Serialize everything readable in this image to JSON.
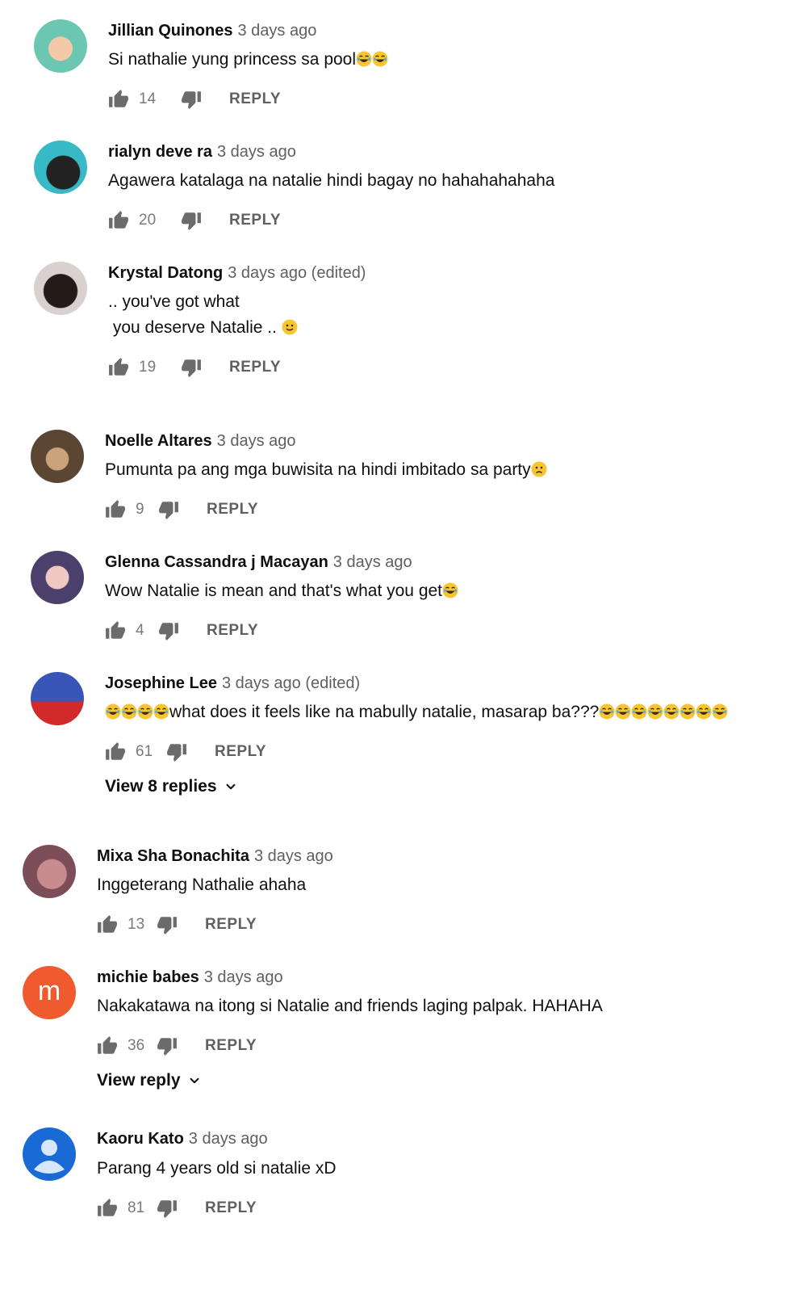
{
  "ui": {
    "reply_label": "REPLY"
  },
  "comments": [
    {
      "author": "Jillian Quinones",
      "time": "3 days ago",
      "line1": "Si nathalie yung princess sa pool",
      "likes": "14",
      "avatar_colors": [
        "#6cc7b2",
        "#f3c9a8"
      ]
    },
    {
      "author": "rialyn deve ra",
      "time": "3 days ago",
      "line1": "Agawera katalaga na natalie hindi bagay no hahahahahaha",
      "likes": "20",
      "avatar_colors": [
        "#37b9c6",
        "#222222"
      ]
    },
    {
      "author": "Krystal Datong",
      "time": "3 days ago (edited)",
      "line1": ".. you've got what",
      "line2": " you deserve Natalie .. ",
      "likes": "19",
      "avatar_colors": [
        "#d8d1d0",
        "#241a18"
      ]
    },
    {
      "author": "Noelle Altares",
      "time": "3 days ago",
      "line1": "Pumunta pa ang mga buwisita na hindi imbitado sa party",
      "likes": "9",
      "avatar_colors": [
        "#5b4634",
        "#caa27b"
      ]
    },
    {
      "author": "Glenna Cassandra j Macayan",
      "time": "3 days ago",
      "line1": "Wow Natalie is mean and that's what you get",
      "likes": "4",
      "avatar_colors": [
        "#4b3f6b",
        "#f1c7c1"
      ]
    },
    {
      "author": "Josephine Lee",
      "time": "3 days ago (edited)",
      "line1": "what does it feels like na mabully natalie, masarap ba???",
      "likes": "61",
      "replies_label": "View 8 replies",
      "avatar_colors": [
        "#3a55b8",
        "#d22a2a"
      ]
    },
    {
      "author": "Mixa Sha Bonachita",
      "time": "3 days ago",
      "line1": "Inggeterang Nathalie ahaha",
      "likes": "13",
      "avatar_colors": [
        "#c88c8e",
        "#7b4e59"
      ]
    },
    {
      "author": "michie babes",
      "time": "3 days ago",
      "line1": "Nakakatawa na itong si Natalie and friends laging palpak. HAHAHA",
      "likes": "36",
      "replies_label": "View reply",
      "avatar_letter": "m",
      "avatar_colors": [
        "#ef5a2e",
        "#ef5a2e"
      ]
    },
    {
      "author": "Kaoru Kato",
      "time": "3 days ago",
      "line1": "Parang 4 years old si natalie xD",
      "likes": "81",
      "avatar_colors": [
        "#1a6ad6",
        "#d6e6fb"
      ]
    }
  ]
}
